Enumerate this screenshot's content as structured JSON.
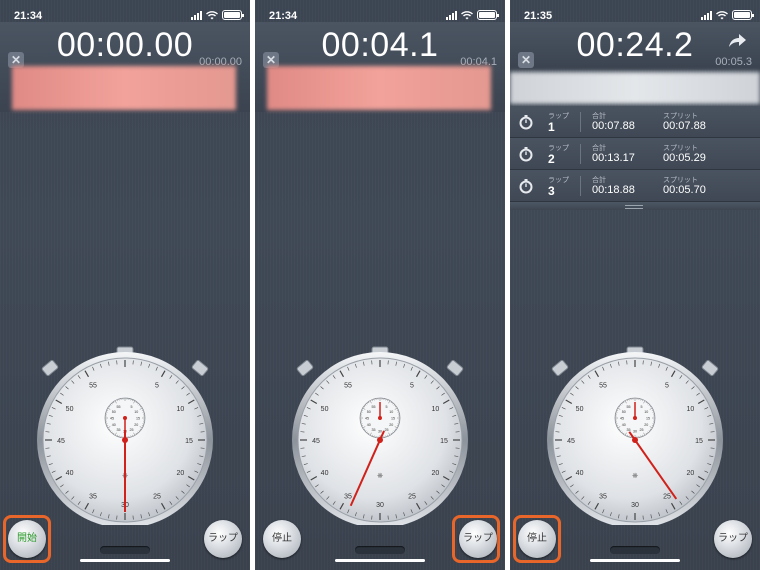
{
  "screens": [
    {
      "status_time": "21:34",
      "main_time": "00:00.00",
      "sub_time": "00:00.00",
      "left_button": "開始",
      "right_button": "ラップ",
      "highlight": "left",
      "seconds_hand_deg": 180,
      "minute_hand_deg": 180
    },
    {
      "status_time": "21:34",
      "main_time": "00:04.1",
      "sub_time": "00:04.1",
      "left_button": "停止",
      "right_button": "ラップ",
      "highlight": "right",
      "seconds_hand_deg": 204,
      "minute_hand_deg": 0
    },
    {
      "status_time": "21:35",
      "main_time": "00:24.2",
      "sub_time": "00:05.3",
      "left_button": "停止",
      "right_button": "ラップ",
      "highlight": "left",
      "seconds_hand_deg": 145,
      "minute_hand_deg": 0,
      "laps": [
        {
          "label": "ラップ",
          "num": "1",
          "total_label": "合計",
          "total": "00:07.88",
          "split_label": "スプリット",
          "split": "00:07.88"
        },
        {
          "label": "ラップ",
          "num": "2",
          "total_label": "合計",
          "total": "00:13.17",
          "split_label": "スプリット",
          "split": "00:05.29"
        },
        {
          "label": "ラップ",
          "num": "3",
          "total_label": "合計",
          "total": "00:18.88",
          "split_label": "スプリット",
          "split": "00:05.70"
        }
      ]
    }
  ],
  "dial": {
    "outer_numbers": [
      "55",
      "5",
      "10",
      "15",
      "20",
      "25",
      "30",
      "35",
      "40",
      "45",
      "50"
    ],
    "inner_numbers": [
      "55",
      "5",
      "10",
      "15",
      "20",
      "25",
      "30",
      "35",
      "40",
      "45",
      "50"
    ],
    "brand_mark": "❋"
  },
  "icons": {
    "close": "✕"
  },
  "colors": {
    "highlight": "#e8662a",
    "hand": "#d0211b",
    "start_text": "#2c9a2c"
  }
}
